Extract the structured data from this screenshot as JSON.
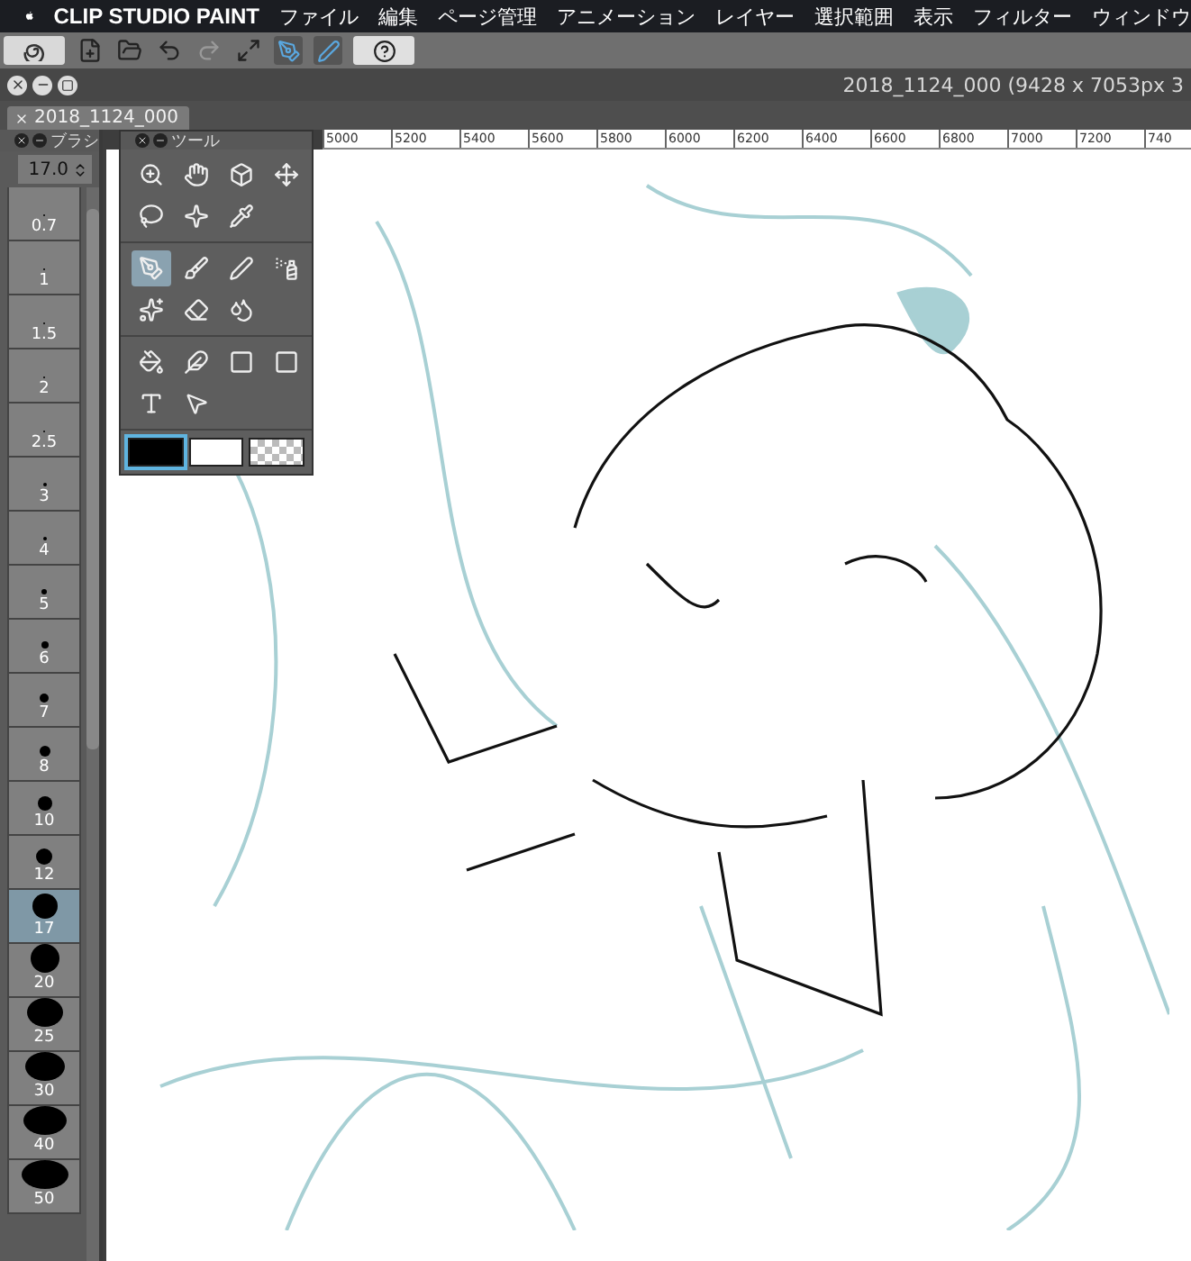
{
  "menu_bar": {
    "app_name": "CLIP STUDIO PAINT",
    "items": [
      "ファイル",
      "編集",
      "ページ管理",
      "アニメーション",
      "レイヤー",
      "選択範囲",
      "表示",
      "フィルター",
      "ウィンドウ"
    ]
  },
  "document": {
    "title": "2018_1124_000 (9428 x 7053px 3",
    "tab": "2018_1124_000"
  },
  "brush_size_panel": {
    "title": "ブラシ",
    "size_value": "17.0",
    "sizes": [
      {
        "label": "0.7",
        "selected": false
      },
      {
        "label": "1",
        "selected": false
      },
      {
        "label": "1.5",
        "selected": false
      },
      {
        "label": "2",
        "selected": false
      },
      {
        "label": "2.5",
        "selected": false
      },
      {
        "label": "3",
        "selected": false
      },
      {
        "label": "4",
        "selected": false
      },
      {
        "label": "5",
        "selected": false
      },
      {
        "label": "6",
        "selected": false
      },
      {
        "label": "7",
        "selected": false
      },
      {
        "label": "8",
        "selected": false
      },
      {
        "label": "10",
        "selected": false
      },
      {
        "label": "12",
        "selected": false
      },
      {
        "label": "17",
        "selected": true
      },
      {
        "label": "20",
        "selected": false
      },
      {
        "label": "25",
        "selected": false
      },
      {
        "label": "30",
        "selected": false
      },
      {
        "label": "40",
        "selected": false
      },
      {
        "label": "50",
        "selected": false
      }
    ]
  },
  "tool_panel": {
    "title": "ツール",
    "sections": [
      {
        "tools": [
          {
            "selected": false
          },
          {
            "selected": false
          },
          {
            "selected": false
          },
          {
            "selected": false
          },
          {
            "selected": false
          },
          {
            "selected": false
          },
          {
            "selected": false
          }
        ]
      },
      {
        "tools": [
          {
            "selected": true
          },
          {
            "selected": false
          },
          {
            "selected": false
          },
          {
            "selected": false
          },
          {
            "selected": false
          },
          {
            "selected": false
          },
          {
            "selected": false
          }
        ]
      },
      {
        "tools": [
          {
            "selected": false
          },
          {
            "selected": false
          },
          {
            "selected": false
          },
          {
            "selected": false
          },
          {
            "selected": false
          },
          {
            "selected": false
          }
        ]
      }
    ],
    "colors": [
      {
        "kind": "main",
        "selected": true
      },
      {
        "kind": "sub",
        "selected": false
      },
      {
        "kind": "transparent",
        "selected": false
      }
    ]
  },
  "ruler": {
    "labels": [
      "5000",
      "5200",
      "5400",
      "5600",
      "5800",
      "6000",
      "6200",
      "6400",
      "6600",
      "6800",
      "7000",
      "7200",
      "740"
    ]
  }
}
